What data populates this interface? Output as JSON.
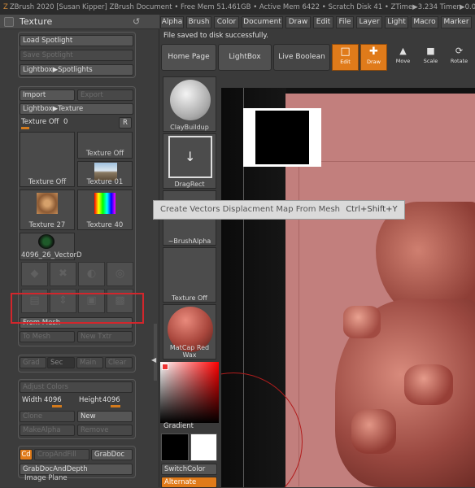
{
  "titlebar": {
    "app": "ZBrush 2020 [Susan Kipper]",
    "doc": "ZBrush Document",
    "free_mem": "• Free Mem 51.461GB",
    "active_mem": "• Active Mem 6422",
    "scratch": "• Scratch Disk 41",
    "ztime": "• ZTime▶3.234 Timer▶0.0"
  },
  "texture_panel": {
    "title": "Texture",
    "load_spotlight": "Load Spotlight",
    "save_spotlight": "Save Spotlight",
    "lightbox_spotlights": "Lightbox▶Spotlights",
    "import": "Import",
    "export": "Export",
    "lightbox_texture": "Lightbox▶Texture",
    "texture_off_label": "Texture Off",
    "texture_off_value": "0",
    "r_button": "R",
    "tiles": [
      "Texture Off",
      "Texture Off",
      "Texture 01",
      "Texture 27",
      "Texture 40",
      "4096_26_VectorD"
    ],
    "from_mesh": "From Mesh",
    "to_mesh": "To Mesh",
    "new_txtr": "New Txtr",
    "grad": "Grad",
    "sec": "Sec",
    "main": "Main",
    "clear": "Clear",
    "adjust_colors": "Adjust Colors",
    "width_label": "Width",
    "width_value": "4096",
    "height_label": "Height",
    "height_value": "4096",
    "clone": "Clone",
    "new": "New",
    "make_alpha": "MakeAlpha",
    "remove": "Remove",
    "cd": "Cd",
    "crop_and_fill": "CropAndFill",
    "grab_doc": "GrabDoc",
    "grab_doc_and_depth": "GrabDocAndDepth",
    "image_plane": "Image Plane"
  },
  "menu": [
    "Alpha",
    "Brush",
    "Color",
    "Document",
    "Draw",
    "Edit",
    "File",
    "Layer",
    "Light",
    "Macro",
    "Marker"
  ],
  "status_message": "File saved to disk successfully.",
  "toolbar": {
    "home_page": "Home Page",
    "lightbox": "LightBox",
    "live_boolean": "Live Boolean",
    "edit": "Edit",
    "draw": "Draw",
    "move": "Move",
    "scale": "Scale",
    "rotate": "Rotate"
  },
  "tool_column": {
    "clay_buildup": "ClayBuildup",
    "drag_rect": "DragRect",
    "brush_alpha": "~BrushAlpha",
    "texture_off": "Texture Off",
    "matcap": "MatCap Red Wax",
    "gradient": "Gradient",
    "switch_color": "SwitchColor",
    "alternate": "Alternate"
  },
  "tooltip": {
    "text": "Create Vectors Displacment Map From Mesh",
    "shortcut": "Ctrl+Shift+Y"
  },
  "colors": {
    "accent": "#e07b1a",
    "highlight": "#d2262c",
    "canvas_skin": "#c27f7d",
    "matcap": "#a8463c"
  }
}
